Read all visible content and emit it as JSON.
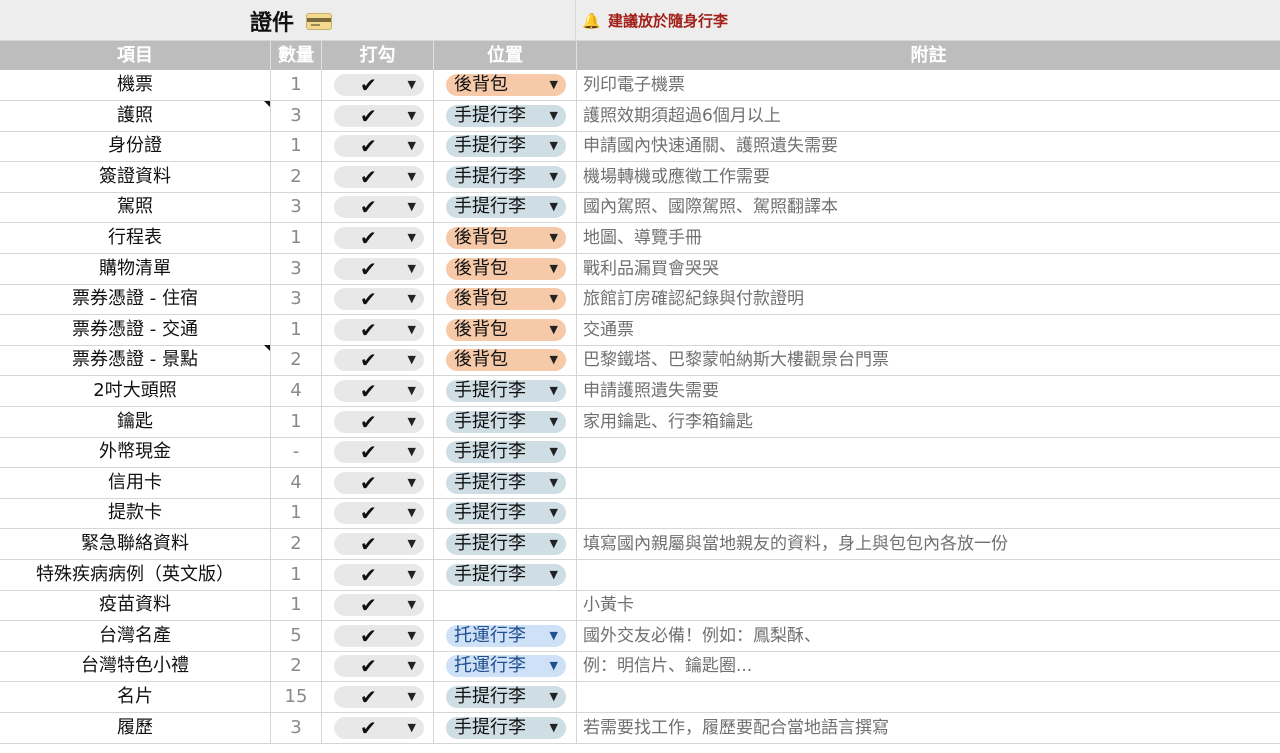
{
  "title": "證件",
  "title_icon": "credit-card-icon",
  "suggestion": "建議放於隨身行李",
  "suggestion_icon": "bell-icon",
  "headers": {
    "item": "項目",
    "qty": "數量",
    "check": "打勾",
    "location": "位置",
    "note": "附註"
  },
  "check_symbol": "✔",
  "dropdown_arrow": "▼",
  "location_colors": {
    "後背包": "#f6c9a9",
    "手提行李": "#cfdde4",
    "托運行李": "#cfe1f7"
  },
  "rows": [
    {
      "item": "機票",
      "qty": "1",
      "location": "後背包",
      "loc_type": "back",
      "note": "列印電子機票",
      "comment": false
    },
    {
      "item": "護照",
      "qty": "3",
      "location": "手提行李",
      "loc_type": "hand",
      "note": "護照效期須超過6個月以上",
      "comment": true
    },
    {
      "item": "身份證",
      "qty": "1",
      "location": "手提行李",
      "loc_type": "hand",
      "note": "申請國內快速通關、護照遺失需要",
      "comment": false
    },
    {
      "item": "簽證資料",
      "qty": "2",
      "location": "手提行李",
      "loc_type": "hand",
      "note": "機場轉機或應徵工作需要",
      "comment": false
    },
    {
      "item": "駕照",
      "qty": "3",
      "location": "手提行李",
      "loc_type": "hand",
      "note": "國內駕照、國際駕照、駕照翻譯本",
      "comment": false
    },
    {
      "item": "行程表",
      "qty": "1",
      "location": "後背包",
      "loc_type": "back",
      "note": "地圖、導覽手冊",
      "comment": false
    },
    {
      "item": "購物清單",
      "qty": "3",
      "location": "後背包",
      "loc_type": "back",
      "note": "戰利品漏買會哭哭",
      "comment": false
    },
    {
      "item": "票券憑證 - 住宿",
      "qty": "3",
      "location": "後背包",
      "loc_type": "back",
      "note": "旅館訂房確認紀錄與付款證明",
      "comment": false
    },
    {
      "item": "票券憑證 - 交通",
      "qty": "1",
      "location": "後背包",
      "loc_type": "back",
      "note": "交通票",
      "comment": false
    },
    {
      "item": "票券憑證 - 景點",
      "qty": "2",
      "location": "後背包",
      "loc_type": "back",
      "note": "巴黎鐵塔、巴黎蒙帕納斯大樓觀景台門票",
      "comment": true
    },
    {
      "item": "2吋大頭照",
      "qty": "4",
      "location": "手提行李",
      "loc_type": "hand",
      "note": "申請護照遺失需要",
      "comment": false
    },
    {
      "item": "鑰匙",
      "qty": "1",
      "location": "手提行李",
      "loc_type": "hand",
      "note": "家用鑰匙、行李箱鑰匙",
      "comment": false
    },
    {
      "item": "外幣現金",
      "qty": "-",
      "location": "手提行李",
      "loc_type": "hand",
      "note": "",
      "comment": false
    },
    {
      "item": "信用卡",
      "qty": "4",
      "location": "手提行李",
      "loc_type": "hand",
      "note": "",
      "comment": false
    },
    {
      "item": "提款卡",
      "qty": "1",
      "location": "手提行李",
      "loc_type": "hand",
      "note": "",
      "comment": false
    },
    {
      "item": "緊急聯絡資料",
      "qty": "2",
      "location": "手提行李",
      "loc_type": "hand",
      "note": "填寫國內親屬與當地親友的資料，身上與包包內各放一份",
      "comment": false
    },
    {
      "item": "特殊疾病病例（英文版）",
      "qty": "1",
      "location": "手提行李",
      "loc_type": "hand",
      "note": "",
      "comment": false
    },
    {
      "item": "疫苗資料",
      "qty": "1",
      "location": "",
      "loc_type": "none",
      "note": "小黃卡",
      "comment": false
    },
    {
      "item": "台灣名產",
      "qty": "5",
      "location": "托運行李",
      "loc_type": "check",
      "note": "國外交友必備！例如：鳳梨酥、",
      "comment": false
    },
    {
      "item": "台灣特色小禮",
      "qty": "2",
      "location": "托運行李",
      "loc_type": "check",
      "note": "例：明信片、鑰匙圈...",
      "comment": false
    },
    {
      "item": "名片",
      "qty": "15",
      "location": "手提行李",
      "loc_type": "hand",
      "note": "",
      "comment": false
    },
    {
      "item": "履歷",
      "qty": "3",
      "location": "手提行李",
      "loc_type": "hand",
      "note": "若需要找工作，履歷要配合當地語言撰寫",
      "comment": false
    }
  ]
}
